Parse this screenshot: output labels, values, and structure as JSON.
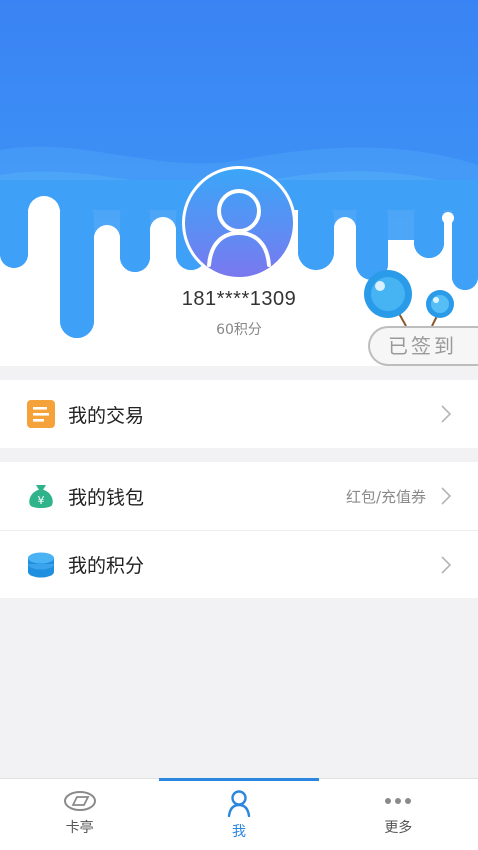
{
  "profile": {
    "phone": "181****1309",
    "points_text": "60积分",
    "signin_label": "已签到"
  },
  "menu": {
    "trade": {
      "label": "我的交易",
      "icon": "document-icon"
    },
    "wallet": {
      "label": "我的钱包",
      "hint": "红包/充值券",
      "icon": "money-bag-icon"
    },
    "points": {
      "label": "我的积分",
      "icon": "coin-stack-icon"
    }
  },
  "tabbar": {
    "tabs": [
      {
        "label": "卡亭",
        "icon": "card-kiosk-icon",
        "active": false
      },
      {
        "label": "我",
        "icon": "user-icon",
        "active": true
      },
      {
        "label": "更多",
        "icon": "more-dots-icon",
        "active": false
      }
    ]
  },
  "colors": {
    "header_blue": "#3b87f5",
    "drip_blue": "#3ea0f7",
    "accent": "#2b86e0",
    "trade_icon": "#f5a23a",
    "wallet_icon": "#2fb38b",
    "points_icon": "#1f8fe0"
  }
}
